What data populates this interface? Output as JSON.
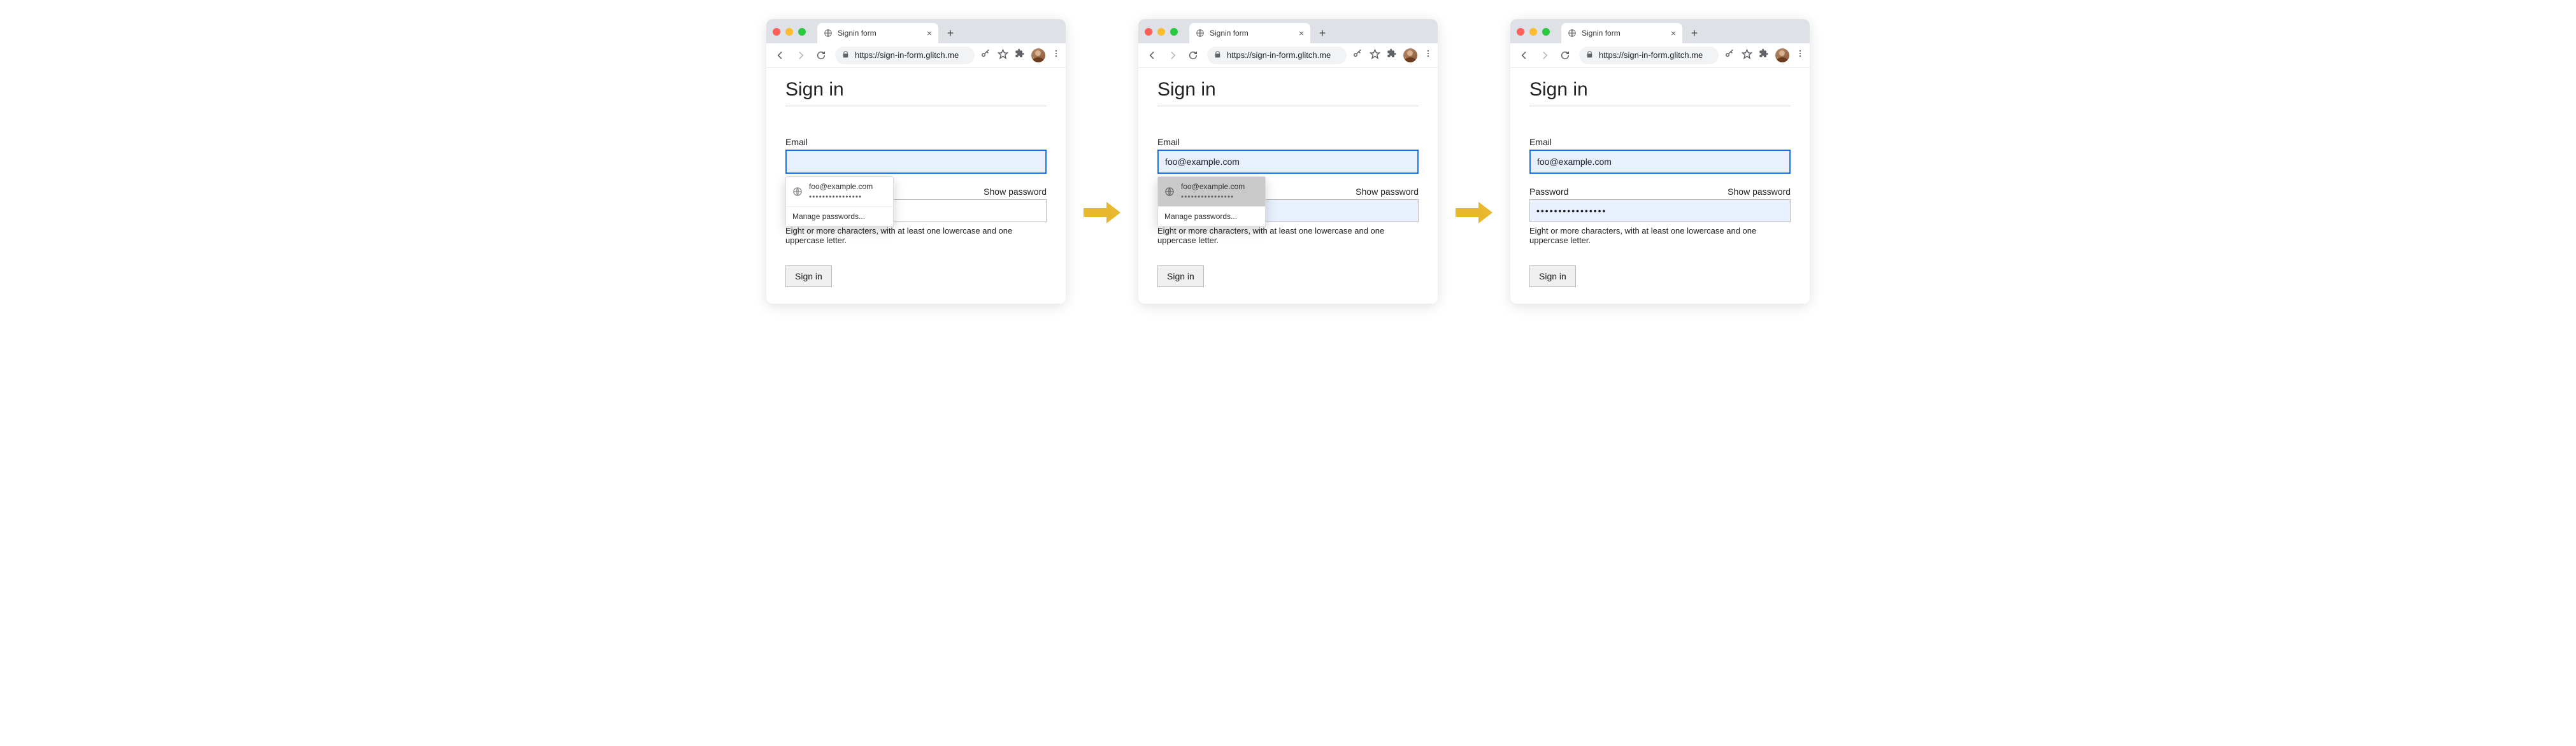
{
  "browser": {
    "tab_title": "Signin form",
    "url": "https://sign-in-form.glitch.me"
  },
  "page": {
    "heading": "Sign in",
    "email_label": "Email",
    "password_label": "Password",
    "show_password": "Show password",
    "hint": "Eight or more characters, with at least one lowercase and one uppercase letter.",
    "submit_label": "Sign in"
  },
  "autofill": {
    "username": "foo@example.com",
    "password_mask": "••••••••••••••••",
    "manage_label": "Manage passwords..."
  },
  "states": {
    "s1_email_value": "",
    "s2_email_value": "foo@example.com",
    "s3_email_value": "foo@example.com",
    "s3_password_mask": "••••••••••••••••"
  }
}
